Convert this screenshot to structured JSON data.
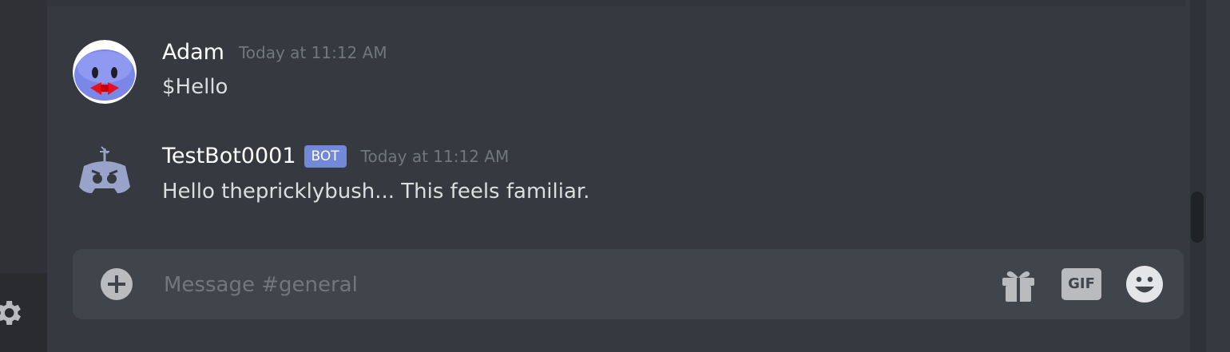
{
  "messages": [
    {
      "username": "Adam",
      "timestamp": "Today at 11:12 AM",
      "content": "$Hello",
      "is_bot": false
    },
    {
      "username": "TestBot0001",
      "badge": "BOT",
      "timestamp": "Today at 11:12 AM",
      "content": "Hello thepricklybush... This feels familiar.",
      "is_bot": true
    }
  ],
  "composer": {
    "placeholder": "Message #general",
    "gif_label": "GIF"
  },
  "icons": {
    "add": "plus-circle-icon",
    "gift": "gift-icon",
    "gif": "gif-icon",
    "emoji": "smiley-emoji-icon",
    "settings": "gear-icon"
  },
  "colors": {
    "background": "#36393f",
    "composer": "#40444b",
    "bot_badge": "#7289da",
    "timestamp": "#72767d",
    "username": "#ffffff"
  }
}
